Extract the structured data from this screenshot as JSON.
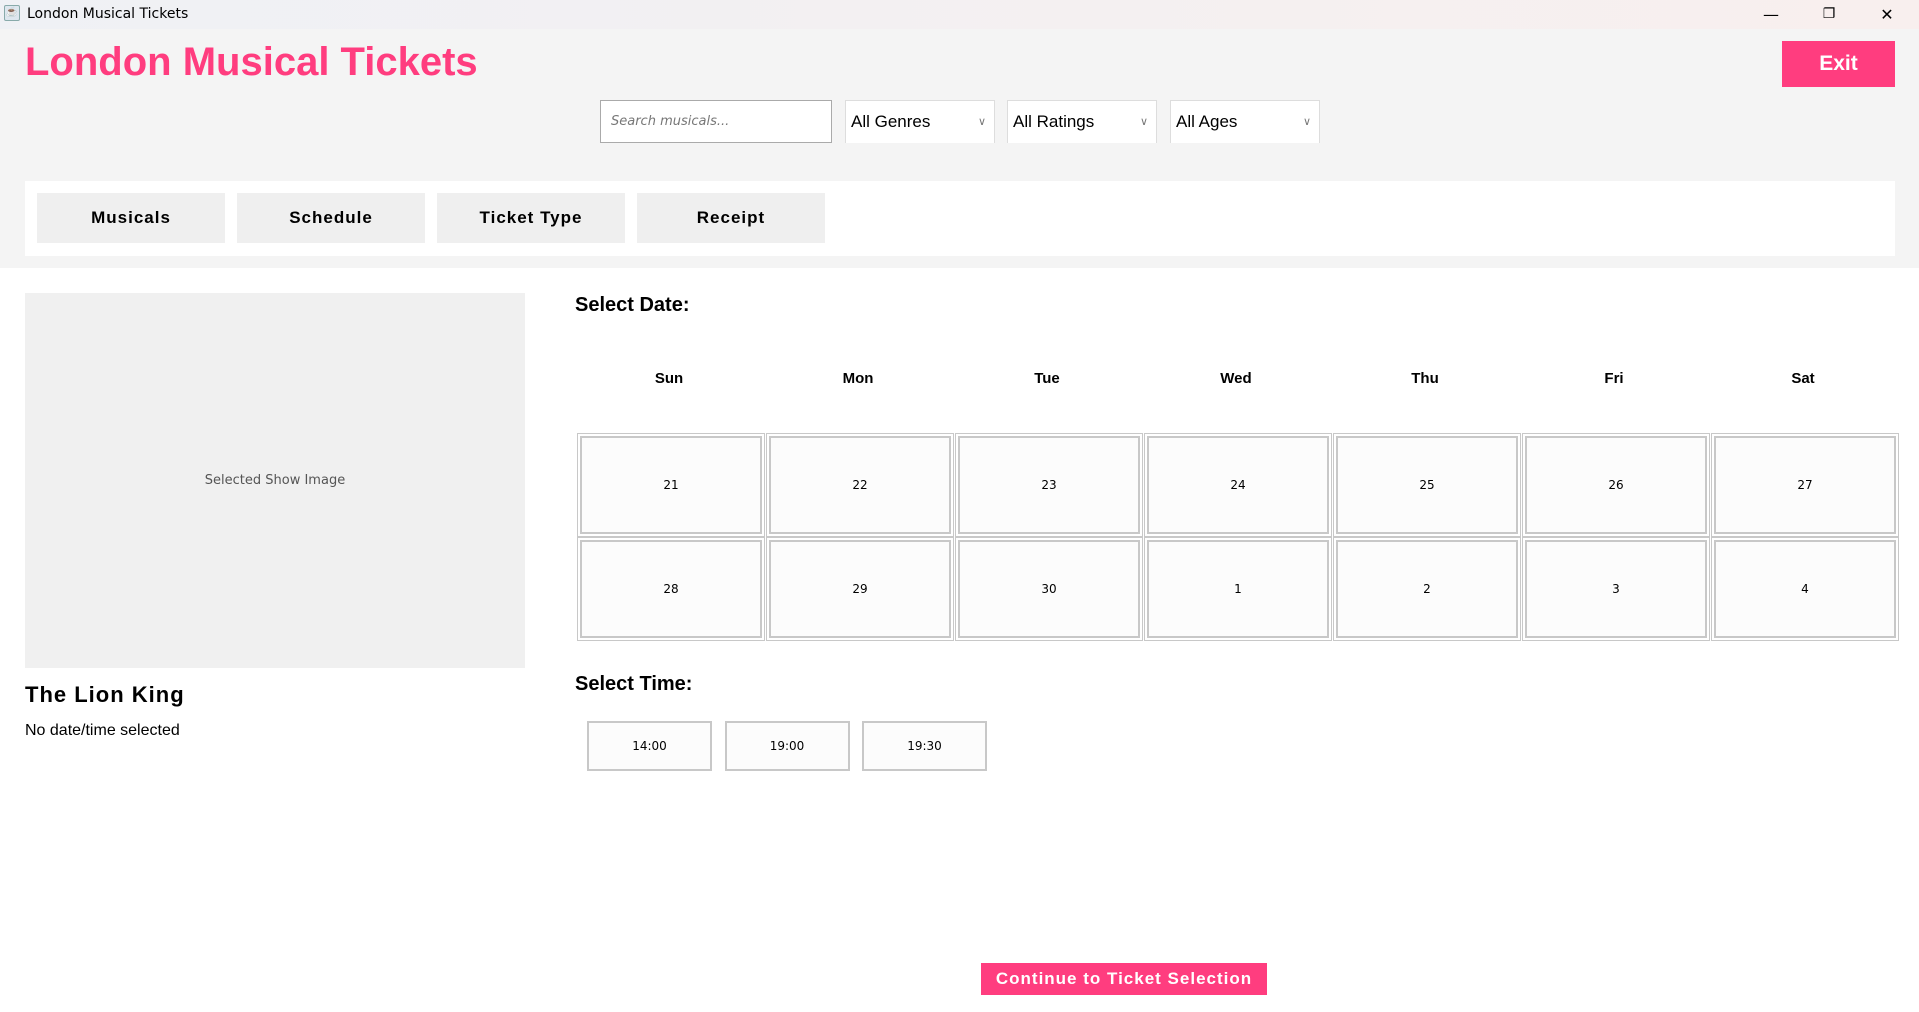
{
  "window": {
    "title": "London Musical Tickets",
    "controls": [
      "minimize-icon",
      "restore-icon",
      "close-icon"
    ]
  },
  "header": {
    "title": "London Musical Tickets",
    "exit_label": "Exit",
    "search": {
      "placeholder": "Search musicals...",
      "value": ""
    },
    "filters": [
      {
        "selected": "All Genres"
      },
      {
        "selected": "All Ratings"
      },
      {
        "selected": "All Ages"
      }
    ]
  },
  "nav": {
    "tabs": [
      {
        "label": "Musicals"
      },
      {
        "label": "Schedule"
      },
      {
        "label": "Ticket Type"
      },
      {
        "label": "Receipt"
      }
    ]
  },
  "show": {
    "image_placeholder": "Selected Show Image",
    "name": "The Lion King",
    "status": "No date/time selected"
  },
  "schedule": {
    "date_heading": "Select Date:",
    "weekdays": [
      "Sun",
      "Mon",
      "Tue",
      "Wed",
      "Thu",
      "Fri",
      "Sat"
    ],
    "dates": [
      [
        "21",
        "22",
        "23",
        "24",
        "25",
        "26",
        "27"
      ],
      [
        "28",
        "29",
        "30",
        "1",
        "2",
        "3",
        "4"
      ]
    ],
    "time_heading": "Select Time:",
    "times": [
      "14:00",
      "19:00",
      "19:30"
    ]
  },
  "continue_label": "Continue to Ticket Selection",
  "colors": {
    "accent": "#ff3d7f",
    "header_bg": "#f4f4f4",
    "tab_bg": "#efefef"
  }
}
